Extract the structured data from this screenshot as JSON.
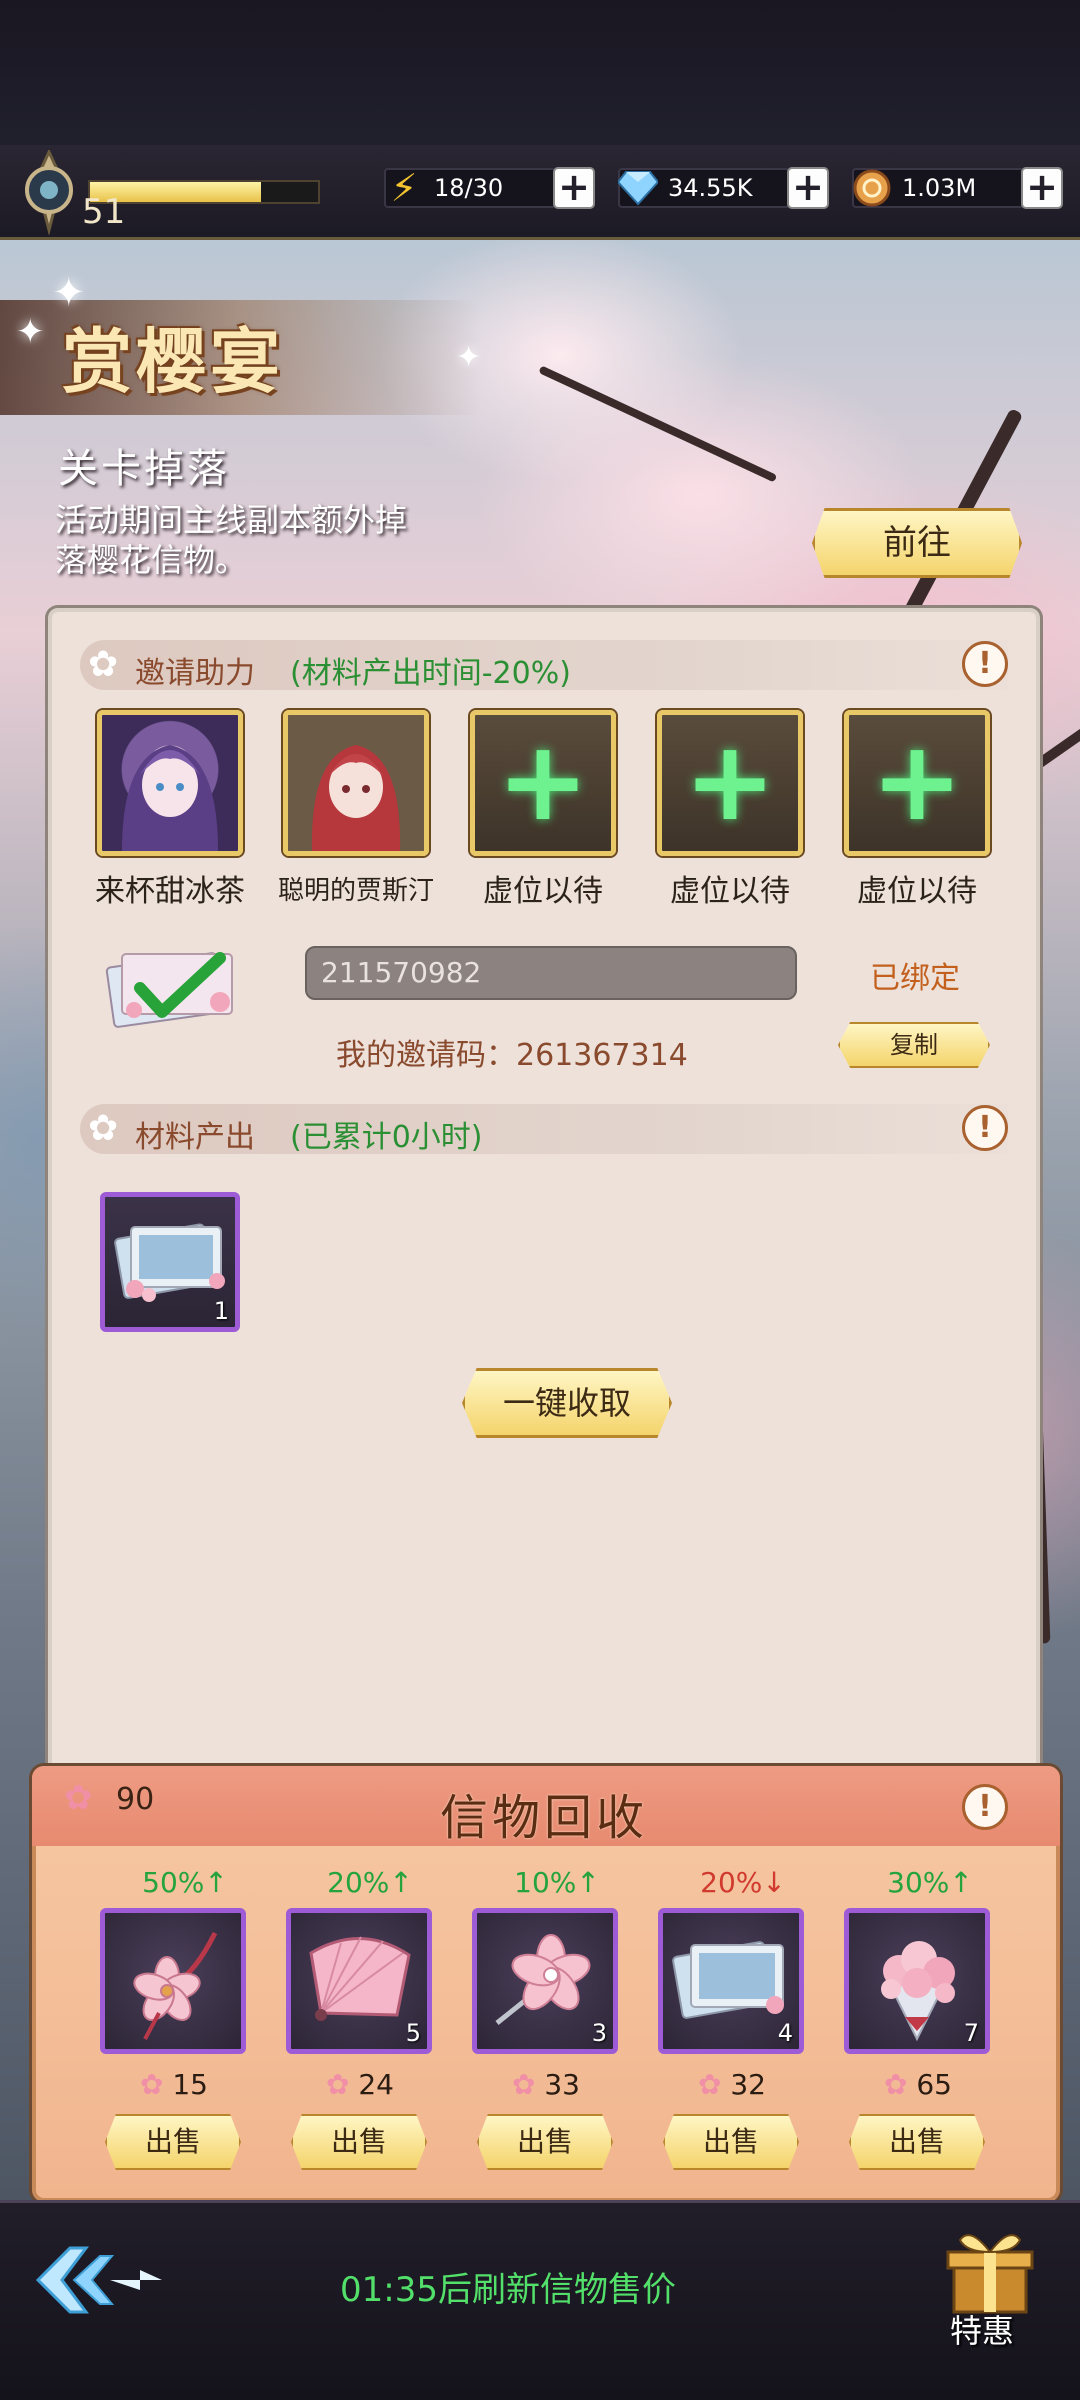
{
  "player": {
    "level": "51",
    "xp_fraction": 0.75
  },
  "resources": {
    "energy": {
      "value": "18/30",
      "icon": "lightning-icon"
    },
    "diamond": {
      "value": "34.55K",
      "icon": "diamond-icon"
    },
    "coin": {
      "value": "1.03M",
      "icon": "coin-icon"
    }
  },
  "event": {
    "title": "赏樱宴",
    "section_title": "关卡掉落",
    "description": "活动期间主线副本额外掉落樱花信物。",
    "go_button": "前往"
  },
  "invite": {
    "header": "邀请助力",
    "note": "(材料产出时间-20%)",
    "slots": [
      {
        "name": "来杯甜冰茶",
        "filled": true
      },
      {
        "name": "聪明的贾斯汀",
        "filled": true
      },
      {
        "name": "虚位以待",
        "filled": false
      },
      {
        "name": "虚位以待",
        "filled": false
      },
      {
        "name": "虚位以待",
        "filled": false
      }
    ],
    "code_input": "211570982",
    "bound_label": "已绑定",
    "my_code": "我的邀请码：261367314",
    "copy_button": "复制"
  },
  "materials": {
    "header": "材料产出",
    "note": "(已累计0小时)",
    "item_count": "1",
    "collect_button": "一键收取"
  },
  "recycle": {
    "title": "信物回收",
    "petals": "90",
    "sell_label": "出售",
    "items": [
      {
        "change": "50%↑",
        "trend": "up",
        "count": "",
        "price": "15",
        "icon": "sakura-charm-icon"
      },
      {
        "change": "20%↑",
        "trend": "up",
        "count": "5",
        "price": "24",
        "icon": "folding-fan-icon"
      },
      {
        "change": "10%↑",
        "trend": "up",
        "count": "3",
        "price": "33",
        "icon": "sakura-hairpin-icon"
      },
      {
        "change": "20%↓",
        "trend": "down",
        "count": "4",
        "price": "32",
        "icon": "postcard-icon"
      },
      {
        "change": "30%↑",
        "trend": "up",
        "count": "7",
        "price": "65",
        "icon": "flower-bouquet-icon"
      }
    ]
  },
  "footer": {
    "refresh_text": "01:35后刷新信物售价",
    "gift_label": "特惠"
  },
  "colors": {
    "accent_green": "#53e06a",
    "up_green": "#25a33c",
    "down_red": "#d13a2e",
    "rare_purple": "#9d5bd6",
    "button_gold": "#f4d46c"
  }
}
